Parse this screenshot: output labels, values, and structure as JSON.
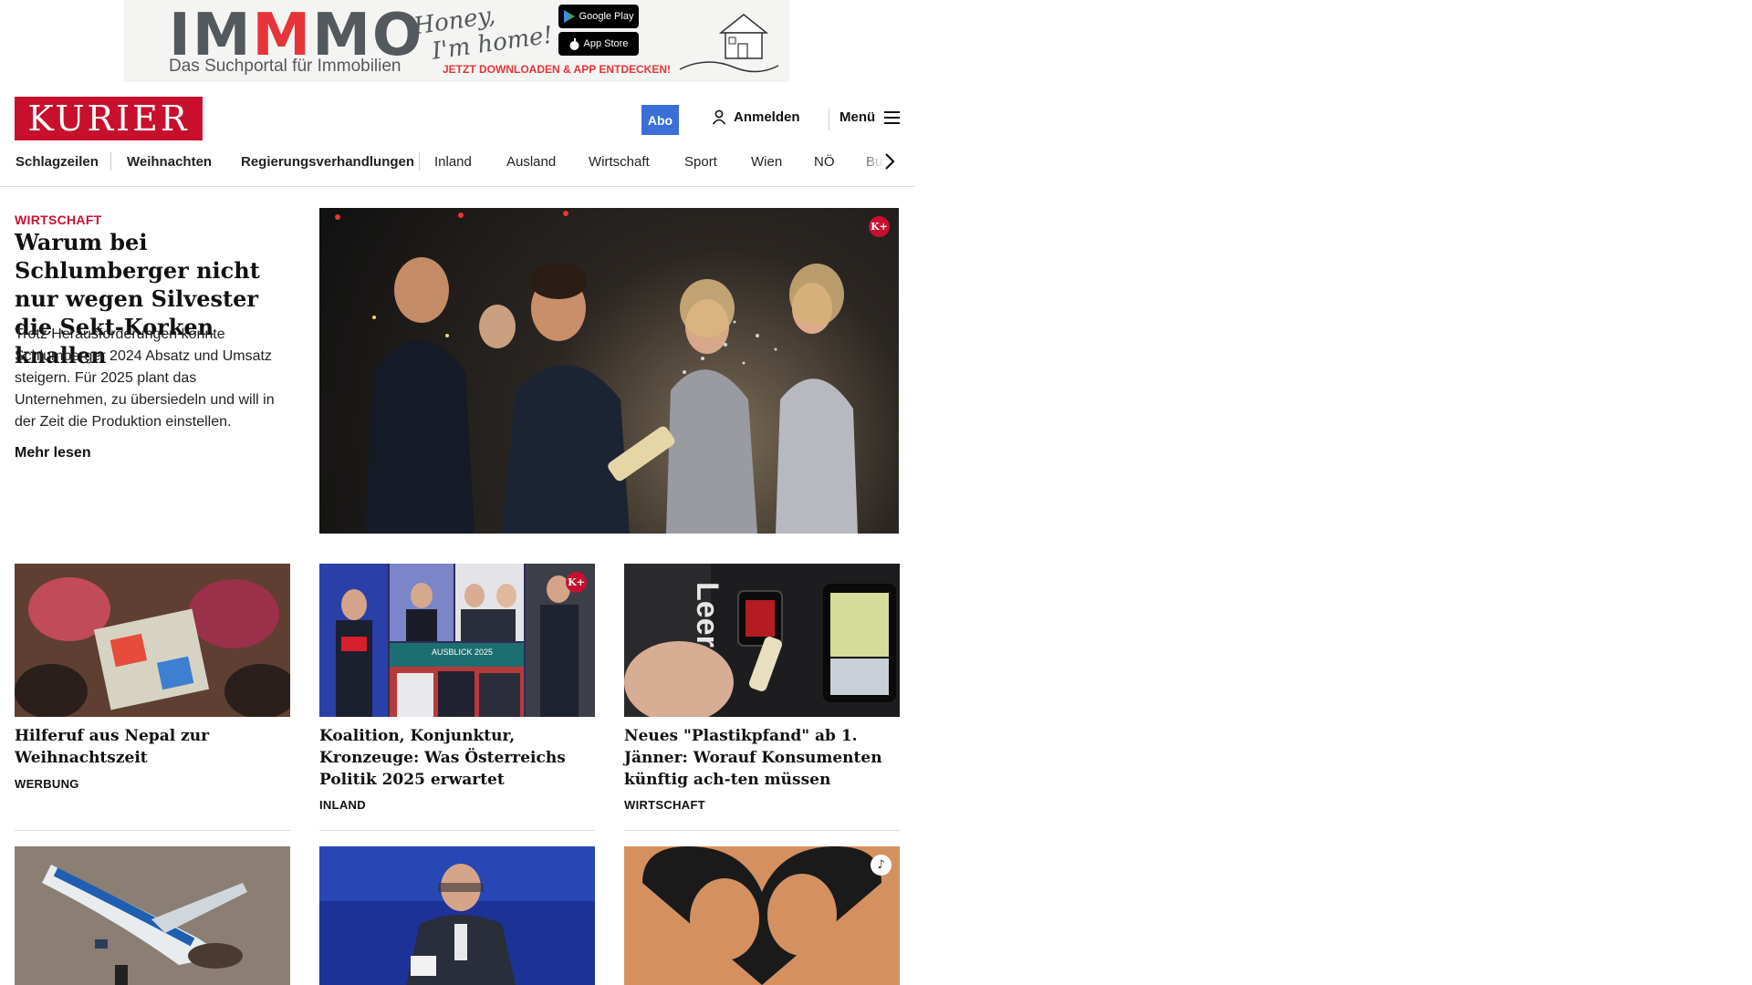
{
  "ad": {
    "logo_a": "IM",
    "logo_m": "M",
    "logo_b": "MO",
    "subtitle": "Das Suchportal für Immobilien",
    "script_line1": "Honey,",
    "script_line2": "I'm home!",
    "google_play": "Google Play",
    "app_store": "App Store",
    "cta": "JETZT DOWNLOADEN & APP ENTDECKEN!"
  },
  "header": {
    "logo": "KURIER",
    "abo": "Abo",
    "login": "Anmelden",
    "menu": "Menü"
  },
  "nav": {
    "items": [
      "Schlagzeilen",
      "Weihnachten",
      "Regierungsverhandlungen",
      "Inland",
      "Ausland",
      "Wirtschaft",
      "Sport",
      "Wien",
      "NÖ",
      "Bu"
    ]
  },
  "hero": {
    "kicker": "WIRTSCHAFT",
    "title": "Warum bei Schlumberger nicht nur wegen Silvester die Sekt-Korken knallen",
    "lead": "Trotz Herausforderungen konnte Schlumberger 2024 Absatz und Umsatz steigern. Für 2025 plant das Unternehmen, zu übersiedeln und will in der Zeit die Produktion einstellen.",
    "more": "Mehr lesen",
    "badge": "K+"
  },
  "cards": [
    {
      "title": "Hilferuf aus Nepal zur Weihnachtszeit",
      "tag": "WERBUNG"
    },
    {
      "title": "Koalition, Konjunktur, Kronzeuge: Was Österreichs Politik 2025 erwartet",
      "tag": "INLAND",
      "badge": "K+",
      "overlay": "AUSBLICK 2025"
    },
    {
      "title": "Neues \"Plastikpfand\" ab 1. Jänner: Worauf Konsumenten künftig ach-ten müssen",
      "tag": "WIRTSCHAFT",
      "overlay": "Leergut"
    }
  ],
  "colors": {
    "brand": "#c8102e",
    "abo": "#3a6fd8"
  }
}
